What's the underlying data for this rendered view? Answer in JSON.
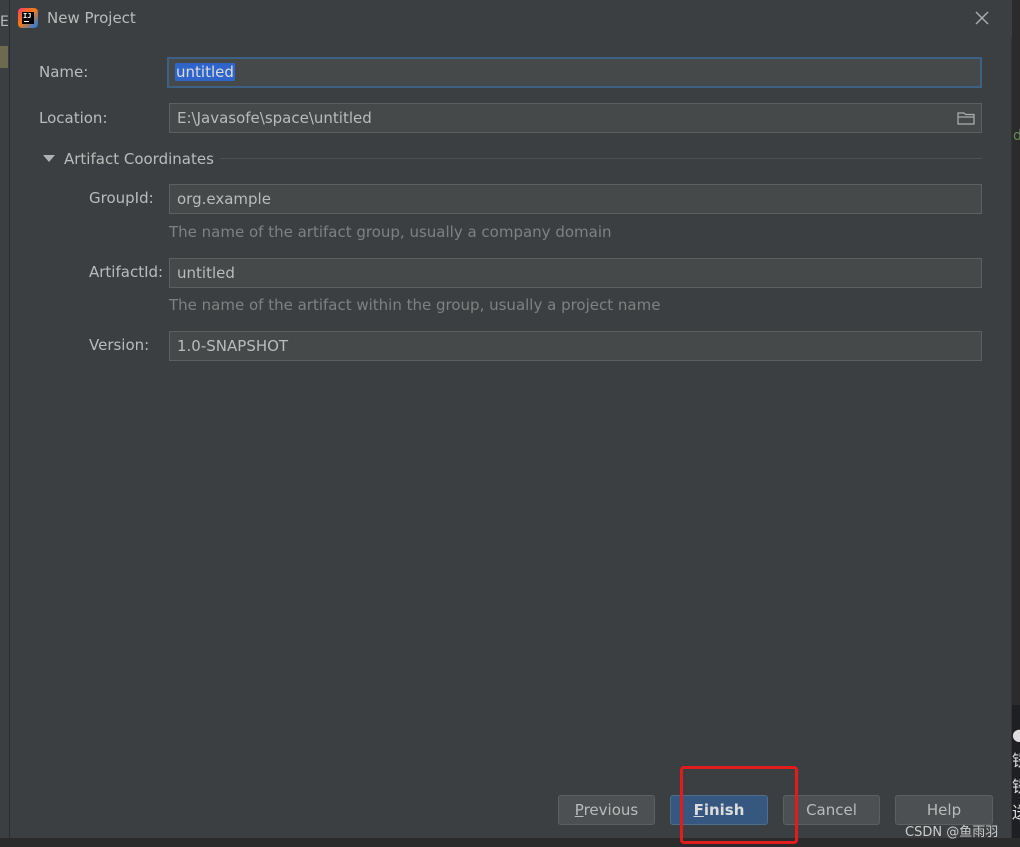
{
  "window": {
    "title": "New Project"
  },
  "form": {
    "name_label": "Name:",
    "name_value": "untitled",
    "location_label": "Location:",
    "location_value": "E:\\Javasofe\\space\\untitled",
    "section_title": "Artifact Coordinates",
    "groupid_label": "GroupId:",
    "groupid_value": "org.example",
    "groupid_hint": "The name of the artifact group, usually a company domain",
    "artifactid_label": "ArtifactId:",
    "artifactid_value": "untitled",
    "artifactid_hint": "The name of the artifact within the group, usually a project name",
    "version_label": "Version:",
    "version_value": "1.0-SNAPSHOT"
  },
  "buttons": {
    "previous_mnemonic": "P",
    "previous_rest": "revious",
    "finish_mnemonic": "F",
    "finish_rest": "inish",
    "cancel": "Cancel",
    "help": "Help"
  },
  "watermark": "CSDN @鱼雨羽",
  "icons": {
    "app": "intellij-idea-icon",
    "close": "close-icon",
    "folder": "folder-icon",
    "collapse": "triangle-down-icon"
  },
  "colors": {
    "dialog_bg": "#3c3f41",
    "field_bg": "#45494a",
    "focus_border": "#3d6185",
    "selection": "#2f65ca",
    "default_button": "#365880",
    "annotation": "#e01c1c"
  }
}
